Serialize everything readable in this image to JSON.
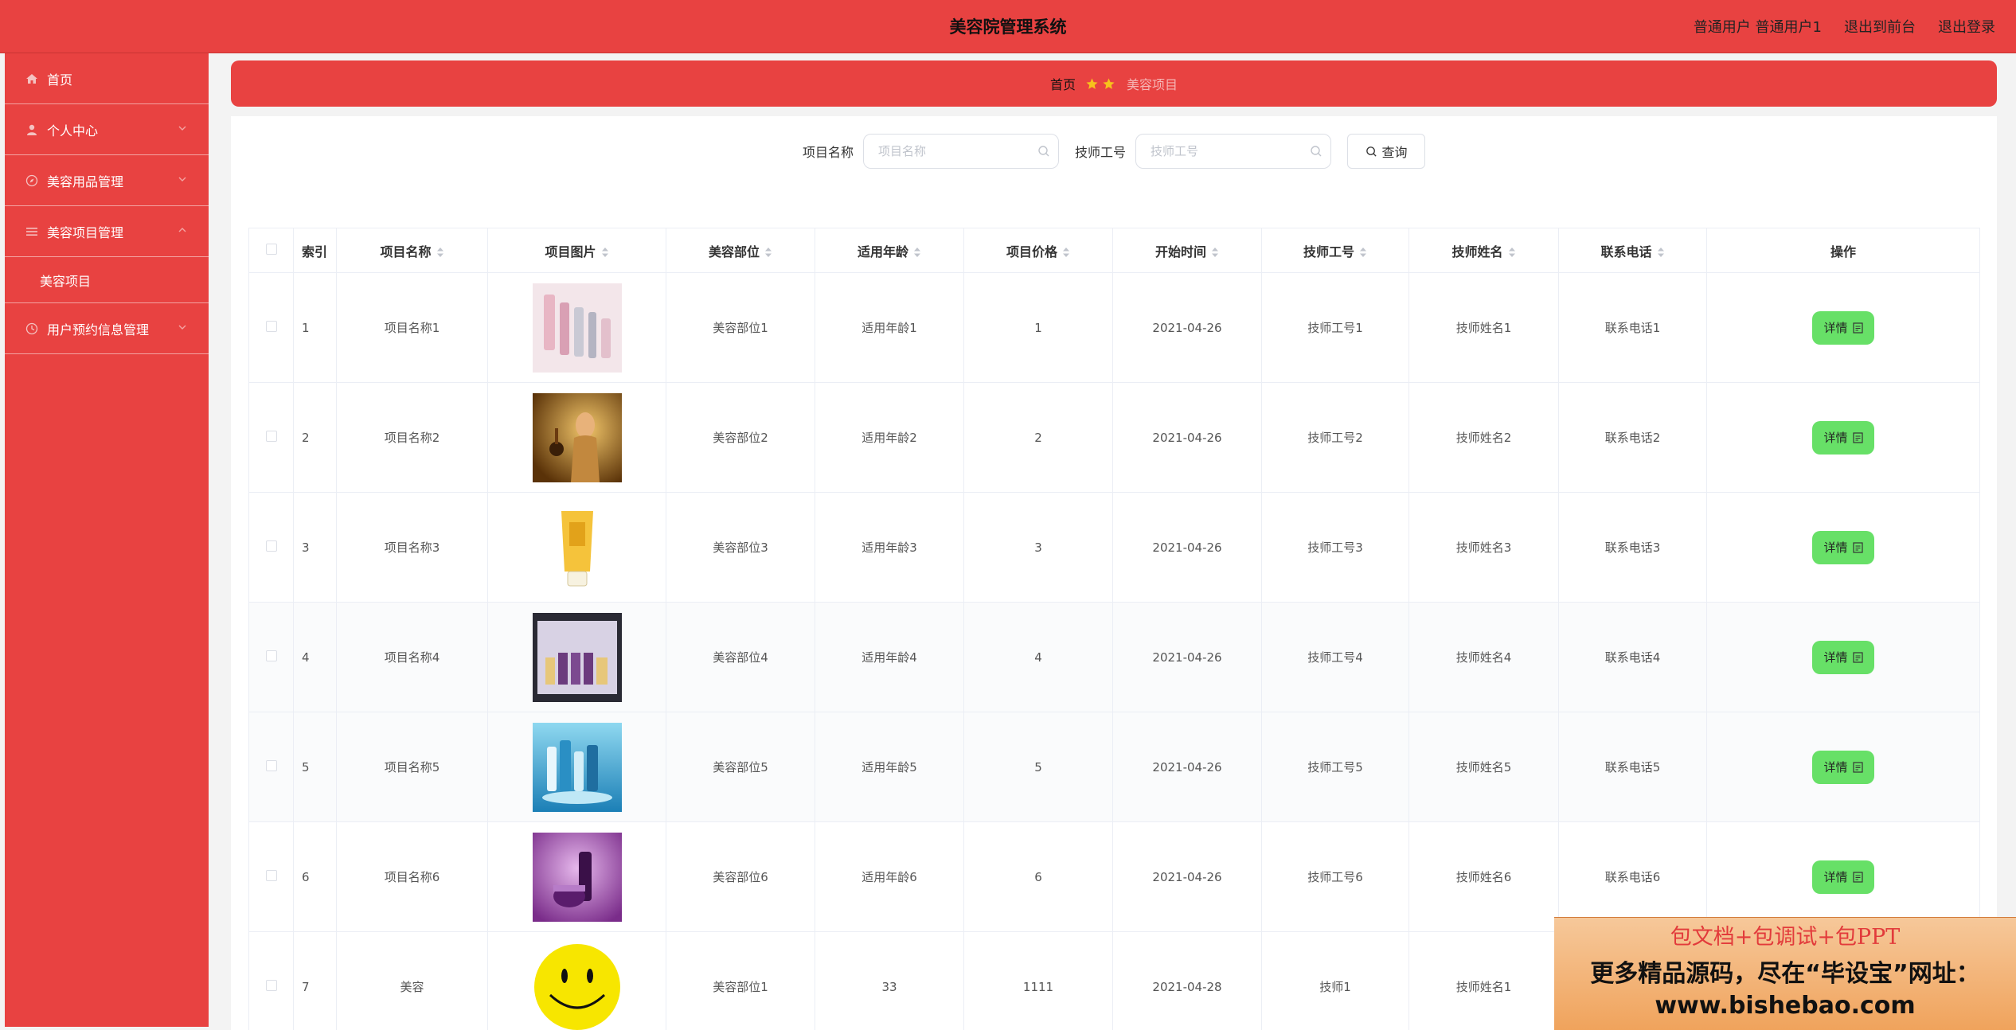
{
  "header": {
    "title": "美容院管理系统",
    "user_role": "普通用户",
    "user_name": "普通用户1",
    "to_front": "退出到前台",
    "logout": "退出登录"
  },
  "sidebar": {
    "items": [
      {
        "label": "首页",
        "icon": "home-icon"
      },
      {
        "label": "个人中心",
        "icon": "user-icon"
      },
      {
        "label": "美容用品管理",
        "icon": "compass-icon"
      },
      {
        "label": "美容项目管理",
        "icon": "menu-icon"
      },
      {
        "label": "用户预约信息管理",
        "icon": "clock-icon"
      }
    ],
    "sub_items": [
      {
        "label": "美容项目"
      }
    ]
  },
  "breadcrumb": {
    "home": "首页",
    "current": "美容项目"
  },
  "search": {
    "name_label": "项目名称",
    "name_placeholder": "项目名称",
    "tech_label": "技师工号",
    "tech_placeholder": "技师工号",
    "query_label": "查询"
  },
  "table": {
    "headers": [
      "索引",
      "项目名称",
      "项目图片",
      "美容部位",
      "适用年龄",
      "项目价格",
      "开始时间",
      "技师工号",
      "技师姓名",
      "联系电话",
      "操作"
    ],
    "rows": [
      {
        "index": "1",
        "name": "项目名称1",
        "image": "cosmetics-bottles-pink",
        "part": "美容部位1",
        "age": "适用年龄1",
        "price": "1",
        "start": "2021-04-26",
        "tech_no": "技师工号1",
        "tech_name": "技师姓名1",
        "phone": "联系电话1"
      },
      {
        "index": "2",
        "name": "项目名称2",
        "image": "perfume-gold",
        "part": "美容部位2",
        "age": "适用年龄2",
        "price": "2",
        "start": "2021-04-26",
        "tech_no": "技师工号2",
        "tech_name": "技师姓名2",
        "phone": "联系电话2"
      },
      {
        "index": "3",
        "name": "项目名称3",
        "image": "yellow-tube",
        "part": "美容部位3",
        "age": "适用年龄3",
        "price": "3",
        "start": "2021-04-26",
        "tech_no": "技师工号3",
        "tech_name": "技师姓名3",
        "phone": "联系电话3"
      },
      {
        "index": "4",
        "name": "项目名称4",
        "image": "gift-box-set",
        "part": "美容部位4",
        "age": "适用年龄4",
        "price": "4",
        "start": "2021-04-26",
        "tech_no": "技师工号4",
        "tech_name": "技师姓名4",
        "phone": "联系电话4"
      },
      {
        "index": "5",
        "name": "项目名称5",
        "image": "blue-water-products",
        "part": "美容部位5",
        "age": "适用年龄5",
        "price": "5",
        "start": "2021-04-26",
        "tech_no": "技师工号5",
        "tech_name": "技师姓名5",
        "phone": "联系电话5"
      },
      {
        "index": "6",
        "name": "项目名称6",
        "image": "purple-jars",
        "part": "美容部位6",
        "age": "适用年龄6",
        "price": "6",
        "start": "2021-04-26",
        "tech_no": "技师工号6",
        "tech_name": "技师姓名6",
        "phone": "联系电话6"
      },
      {
        "index": "7",
        "name": "美容",
        "image": "smiley-face",
        "part": "美容部位1",
        "age": "33",
        "price": "1111",
        "start": "2021-04-28",
        "tech_no": "技师1",
        "tech_name": "技师姓名1",
        "phone": ""
      }
    ],
    "detail_label": "详情"
  },
  "banner": {
    "line1": "包文档+包调试+包PPT",
    "line2": "更多精品源码，尽在“毕设宝”网址：",
    "line3": "www.bishebao.com"
  },
  "colors": {
    "primary": "#e84241",
    "detail_button": "#67e067",
    "star": "#f7c21c"
  }
}
